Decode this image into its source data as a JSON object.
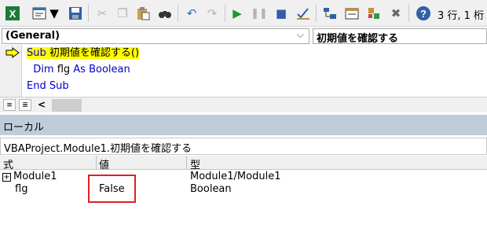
{
  "toolbar": {
    "icons": [
      "excel-icon",
      "insert-module-icon",
      "dropdown-arrow-icon",
      "save-icon",
      "cut-icon",
      "copy-icon",
      "paste-icon",
      "find-icon",
      "undo-icon",
      "redo-icon",
      "run-icon",
      "pause-icon",
      "reset-icon",
      "design-mode-icon",
      "project-explorer-icon",
      "properties-icon",
      "object-browser-icon",
      "toolbox-icon",
      "help-icon"
    ],
    "cursor_position": "3 行, 1 桁"
  },
  "code_window": {
    "object_combo": "(General)",
    "procedure_combo": "初期値を確認する",
    "lines": {
      "line1_kw": "Sub",
      "line1_rest": " 初期値を確認する()",
      "line2_indent": "  ",
      "line2_kw1": "Dim",
      "line2_mid": " flg ",
      "line2_kw2": "As Boolean",
      "line3_kw": "End Sub"
    }
  },
  "locals": {
    "title": "ローカル",
    "context": "VBAProject.Module1.初期値を確認する",
    "headers": {
      "expression": "式",
      "value": "値",
      "type": "型"
    },
    "rows": [
      {
        "expression": "Module1",
        "value": "",
        "type": "Module1/Module1"
      },
      {
        "expression": "flg",
        "value": "False",
        "type": "Boolean"
      }
    ],
    "expander_symbol": "+"
  },
  "colors": {
    "keyword": "#0000c8",
    "execution_highlight": "#ffff00",
    "annotation_box": "#e02020",
    "locals_titlebar": "#bfcddb"
  }
}
